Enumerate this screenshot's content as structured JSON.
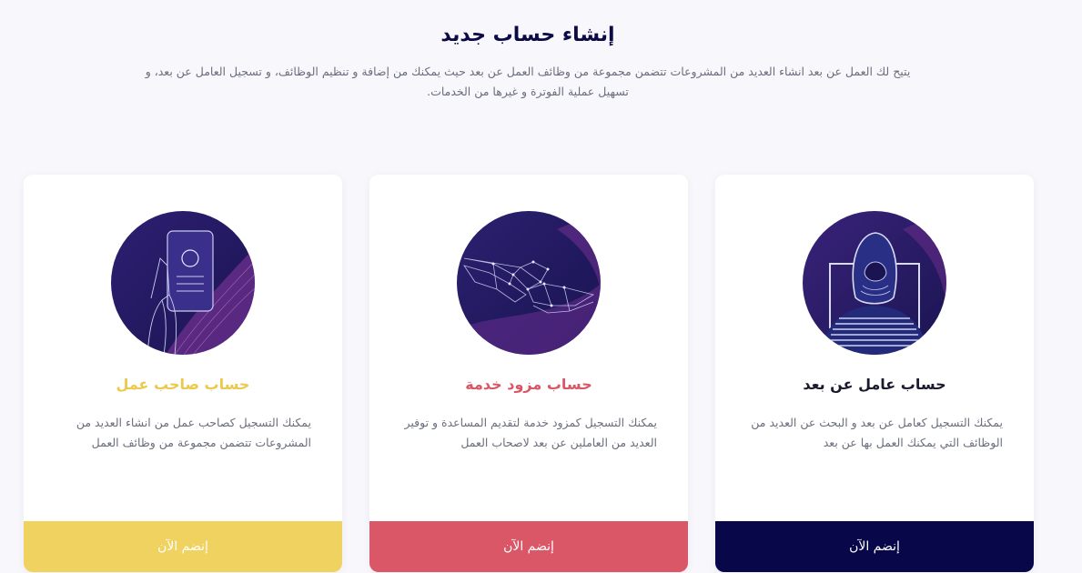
{
  "header": {
    "title": "إنشاء حساب جديد",
    "description": "يتيح لك العمل عن بعد انشاء العديد من المشروعات تتضمن مجموعة من وظائف العمل عن بعد حيث يمكنك من إضافة و تنظيم الوظائف، و تسجيل العامل عن بعد، و تسهيل عملية الفوترة و غيرها من الخدمات."
  },
  "cards": {
    "worker": {
      "title": "حساب عامل عن بعد",
      "description": "يمكنك التسجيل كعامل عن بعد و البحث عن العديد من الوظائف التي يمكنك العمل بها عن بعد",
      "button": "إنضم الآن",
      "accent": "#07074a",
      "title_color": "#1b1b2e",
      "icon": "remote-worker-icon"
    },
    "provider": {
      "title": "حساب مزود خدمة",
      "description": "يمكنك التسجيل كمزود خدمة لتقديم المساعدة و توفير العديد من العاملين عن بعد لاصحاب العمل",
      "button": "إنضم الآن",
      "accent": "#d95766",
      "title_color": "#d95766",
      "icon": "handshake-icon"
    },
    "employer": {
      "title": "حساب صاحب عمل",
      "description": "يمكنك التسجيل كصاحب عمل من انشاء العديد من المشروعات تتضمن مجموعة من وظائف العمل",
      "button": "إنضم الآن",
      "accent": "#f0d260",
      "title_color": "#ecc94b",
      "icon": "mobile-hand-icon"
    }
  }
}
